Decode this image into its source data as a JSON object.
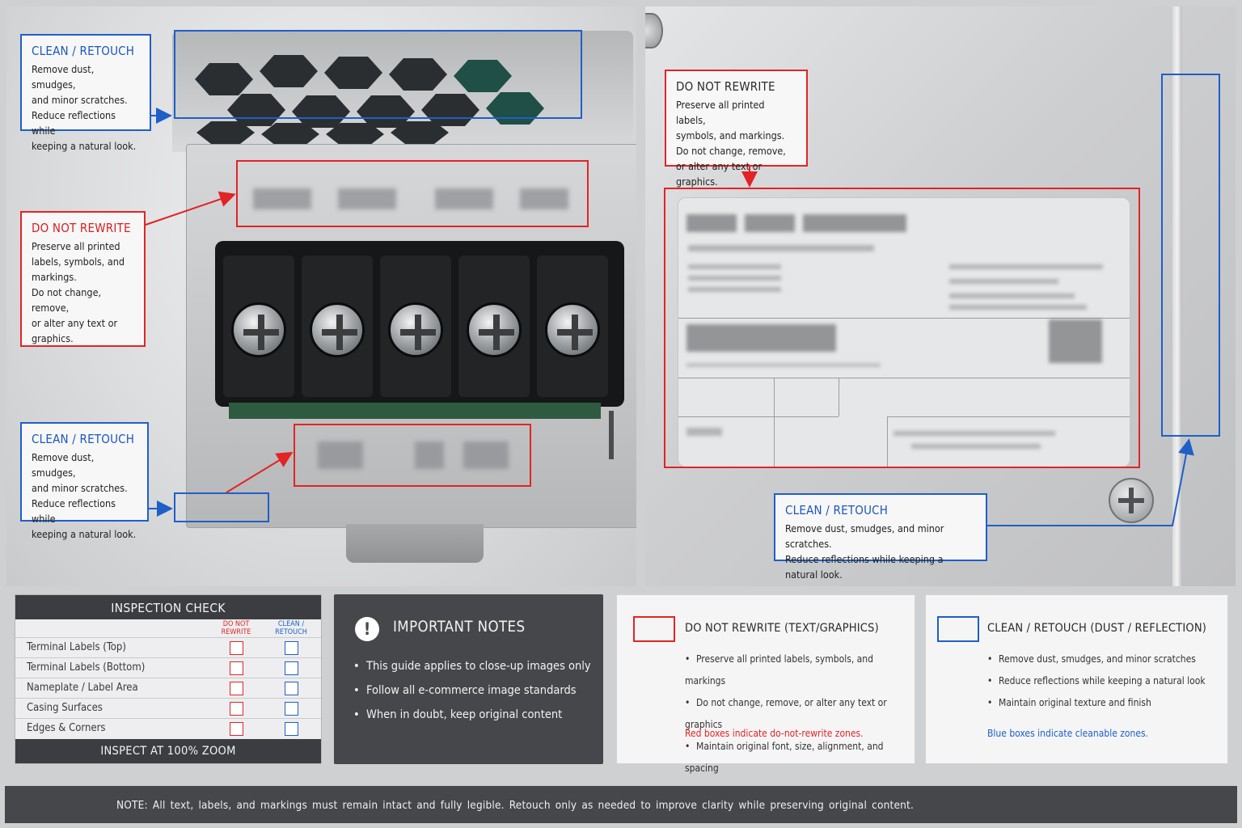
{
  "callouts": {
    "top_left_clean": {
      "title": "CLEAN / RETOUCH",
      "lines": [
        "Remove dust, smudges,",
        "and minor scratches.",
        "Reduce reflections while",
        "keeping a natural look."
      ]
    },
    "mid_left_rewrite": {
      "title": "DO NOT REWRITE",
      "lines": [
        "Preserve all printed",
        "labels, symbols, and",
        "markings.",
        "Do not change, remove,",
        "or alter any text or",
        "graphics."
      ]
    },
    "bottom_left_clean": {
      "title": "CLEAN / RETOUCH",
      "lines": [
        "Remove dust, smudges,",
        "and minor scratches.",
        "Reduce reflections while",
        "keeping a natural look."
      ]
    },
    "top_right_rewrite": {
      "title": "DO NOT REWRITE",
      "lines": [
        "Preserve all printed labels,",
        "symbols, and markings.",
        "Do not change, remove,",
        "or alter any text or graphics."
      ]
    },
    "bottom_right_clean": {
      "title": "CLEAN / RETOUCH",
      "lines": [
        "Remove dust, smudges, and minor scratches.",
        "Reduce reflections while keeping a natural look."
      ]
    }
  },
  "inspection": {
    "title": "INSPECTION CHECK",
    "col_red": [
      "DO NOT",
      "REWRITE"
    ],
    "col_blue": [
      "CLEAN /",
      "RETOUCH"
    ],
    "rows": [
      "Terminal Labels (Top)",
      "Terminal Labels (Bottom)",
      "Nameplate / Label Area",
      "Casing Surfaces",
      "Edges & Corners"
    ],
    "footer": "INSPECT AT 100% ZOOM"
  },
  "notes": {
    "icon": "exclamation-icon",
    "title": "IMPORTANT NOTES",
    "items": [
      "This guide applies to close-up images only",
      "Follow all e-commerce image standards",
      "When in doubt, keep original content"
    ]
  },
  "legend_red": {
    "title": "DO NOT REWRITE (TEXT/GRAPHICS)",
    "items": [
      "Preserve all printed labels, symbols, and markings",
      "Do not change, remove, or alter any text or graphics",
      "Maintain original font, size, alignment, and spacing"
    ],
    "footer": "Red boxes indicate do-not-rewrite zones."
  },
  "legend_blue": {
    "title": "CLEAN / RETOUCH (DUST / REFLECTION)",
    "items": [
      "Remove dust, smudges, and minor scratches",
      "Reduce reflections while keeping a natural look",
      "Maintain original texture and finish"
    ],
    "footer": "Blue boxes indicate cleanable zones."
  },
  "footer_note": "NOTE:  All  text,  labels,  and  markings  must  remain  intact  and  fully  legible.  Retouch  only  as  needed  to  improve  clarity  while  preserving  original  content.",
  "colors": {
    "red_zone": "#e22424",
    "blue_zone": "#1f5fc8",
    "dark_panel": "#45474a"
  }
}
